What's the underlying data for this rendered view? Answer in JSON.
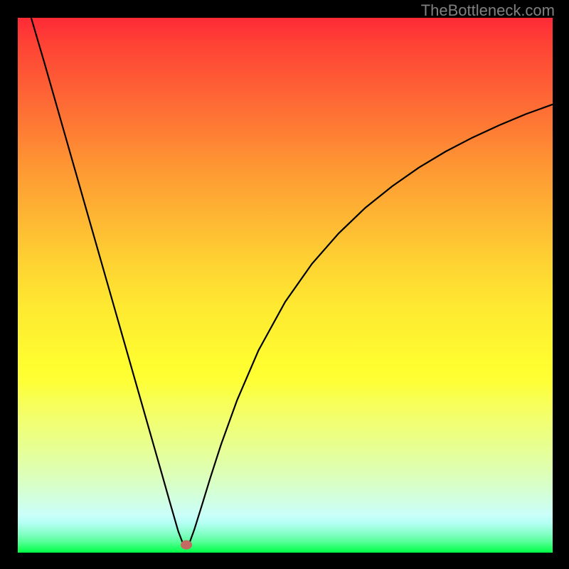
{
  "watermark": "TheBottleneck.com",
  "chart_data": {
    "type": "line",
    "title": "",
    "xlabel": "",
    "ylabel": "",
    "xlim": [
      0,
      100
    ],
    "ylim": [
      0,
      100
    ],
    "grid": false,
    "legend": false,
    "marker": {
      "x": 31.5,
      "y": 1.5,
      "color": "#c36b62"
    },
    "series": [
      {
        "name": "curve",
        "color": "#000000",
        "x": [
          2.5,
          5,
          8,
          11,
          14,
          17,
          20,
          23,
          25,
          27,
          28.5,
          30,
          30.8,
          31.5,
          32.2,
          33,
          34.5,
          36,
          38,
          41,
          45,
          50,
          55,
          60,
          65,
          70,
          75,
          80,
          85,
          90,
          95,
          100
        ],
        "values": [
          100,
          91.5,
          81,
          70.5,
          60,
          49.5,
          39,
          28.5,
          21.5,
          14.5,
          9.2,
          4.0,
          1.9,
          1.3,
          2.1,
          4.3,
          9.1,
          14.0,
          20.2,
          28.5,
          37.8,
          46.9,
          54.0,
          59.7,
          64.5,
          68.5,
          72.0,
          75.0,
          77.6,
          79.9,
          82.0,
          83.8
        ]
      }
    ],
    "background_gradient": {
      "top": "#fe2a36",
      "middle": "#fffe30",
      "bottom": "#01ff46"
    }
  }
}
